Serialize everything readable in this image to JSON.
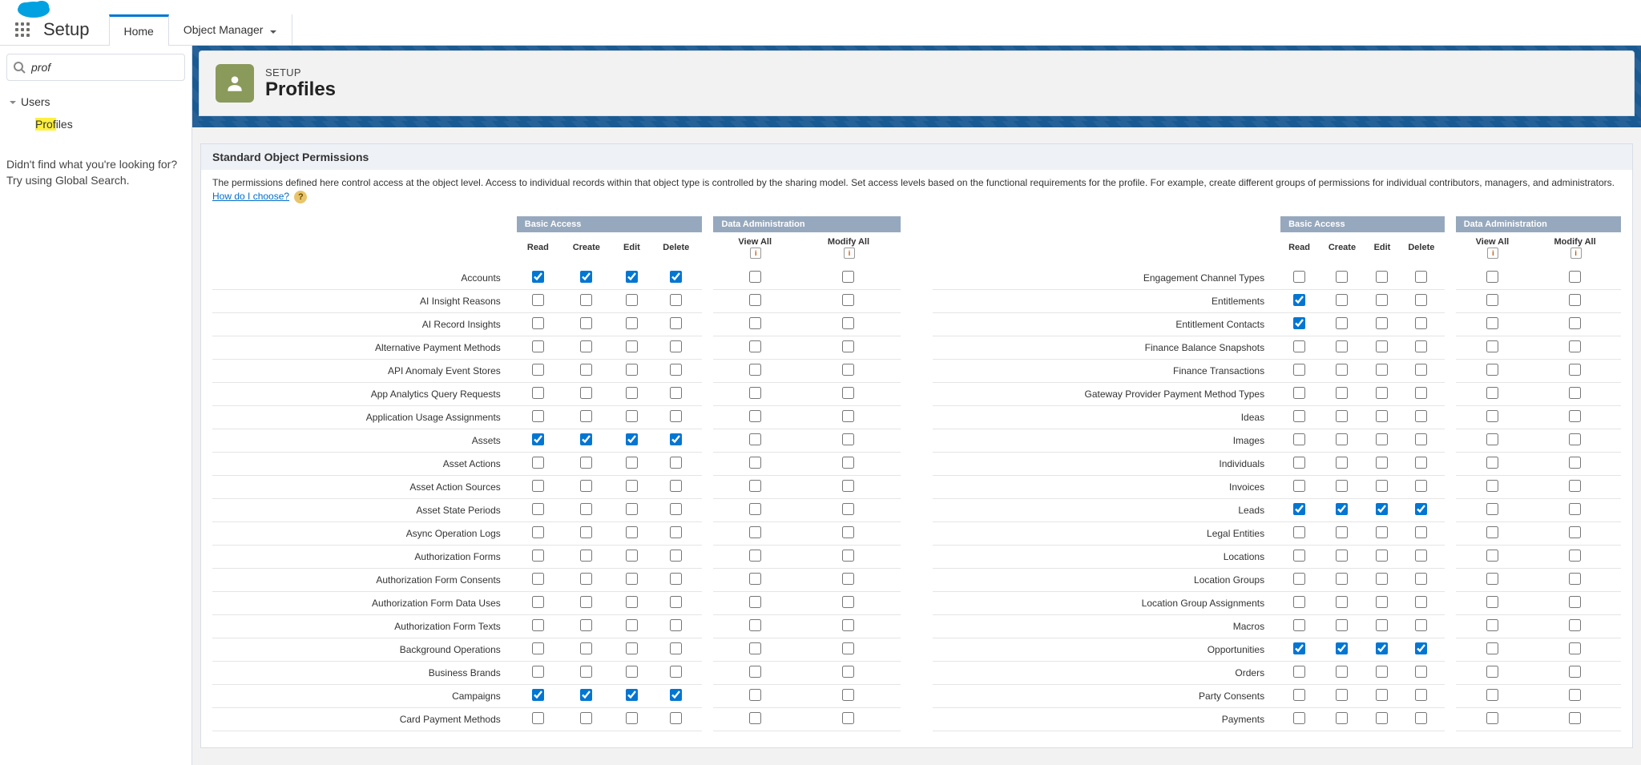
{
  "top": {
    "app_label": "Setup",
    "tabs": [
      {
        "label": "Home",
        "active": true
      },
      {
        "label": "Object Manager",
        "active": false,
        "dropdown": true
      }
    ]
  },
  "sidebar": {
    "search_value": "prof",
    "tree": {
      "root_label": "Users",
      "child_prefix": "Prof",
      "child_suffix": "iles"
    },
    "help_line1": "Didn't find what you're looking for?",
    "help_line2": "Try using Global Search."
  },
  "header": {
    "eyebrow": "SETUP",
    "title": "Profiles"
  },
  "section": {
    "title": "Standard Object Permissions",
    "desc_prefix": "The permissions defined here control access at the object level. Access to individual records within that object type is controlled by the sharing model. Set access levels based on the functional requirements for the profile. For example, create different groups of permissions for individual contributors, managers, and administrators. ",
    "link_text": "How do I choose?"
  },
  "columns": {
    "group_basic": "Basic Access",
    "group_data": "Data Administration",
    "cols": [
      "Read",
      "Create",
      "Edit",
      "Delete",
      "View All",
      "Modify All"
    ]
  },
  "permissions_left": [
    {
      "label": "Accounts",
      "c": [
        true,
        true,
        true,
        true,
        false,
        false
      ]
    },
    {
      "label": "AI Insight Reasons",
      "c": [
        false,
        false,
        false,
        false,
        false,
        false
      ]
    },
    {
      "label": "AI Record Insights",
      "c": [
        false,
        false,
        false,
        false,
        false,
        false
      ]
    },
    {
      "label": "Alternative Payment Methods",
      "c": [
        false,
        false,
        false,
        false,
        false,
        false
      ]
    },
    {
      "label": "API Anomaly Event Stores",
      "c": [
        false,
        false,
        false,
        false,
        false,
        false
      ]
    },
    {
      "label": "App Analytics Query Requests",
      "c": [
        false,
        false,
        false,
        false,
        false,
        false
      ]
    },
    {
      "label": "Application Usage Assignments",
      "c": [
        false,
        false,
        false,
        false,
        false,
        false
      ]
    },
    {
      "label": "Assets",
      "c": [
        true,
        true,
        true,
        true,
        false,
        false
      ]
    },
    {
      "label": "Asset Actions",
      "c": [
        false,
        false,
        false,
        false,
        false,
        false
      ]
    },
    {
      "label": "Asset Action Sources",
      "c": [
        false,
        false,
        false,
        false,
        false,
        false
      ]
    },
    {
      "label": "Asset State Periods",
      "c": [
        false,
        false,
        false,
        false,
        false,
        false
      ]
    },
    {
      "label": "Async Operation Logs",
      "c": [
        false,
        false,
        false,
        false,
        false,
        false
      ]
    },
    {
      "label": "Authorization Forms",
      "c": [
        false,
        false,
        false,
        false,
        false,
        false
      ]
    },
    {
      "label": "Authorization Form Consents",
      "c": [
        false,
        false,
        false,
        false,
        false,
        false
      ]
    },
    {
      "label": "Authorization Form Data Uses",
      "c": [
        false,
        false,
        false,
        false,
        false,
        false
      ]
    },
    {
      "label": "Authorization Form Texts",
      "c": [
        false,
        false,
        false,
        false,
        false,
        false
      ]
    },
    {
      "label": "Background Operations",
      "c": [
        false,
        false,
        false,
        false,
        false,
        false
      ]
    },
    {
      "label": "Business Brands",
      "c": [
        false,
        false,
        false,
        false,
        false,
        false
      ]
    },
    {
      "label": "Campaigns",
      "c": [
        true,
        true,
        true,
        true,
        false,
        false
      ]
    },
    {
      "label": "Card Payment Methods",
      "c": [
        false,
        false,
        false,
        false,
        false,
        false
      ]
    }
  ],
  "permissions_right": [
    {
      "label": "Engagement Channel Types",
      "c": [
        false,
        false,
        false,
        false,
        false,
        false
      ]
    },
    {
      "label": "Entitlements",
      "c": [
        true,
        false,
        false,
        false,
        false,
        false
      ]
    },
    {
      "label": "Entitlement Contacts",
      "c": [
        true,
        false,
        false,
        false,
        false,
        false
      ]
    },
    {
      "label": "Finance Balance Snapshots",
      "c": [
        false,
        false,
        false,
        false,
        false,
        false
      ]
    },
    {
      "label": "Finance Transactions",
      "c": [
        false,
        false,
        false,
        false,
        false,
        false
      ]
    },
    {
      "label": "Gateway Provider Payment Method Types",
      "c": [
        false,
        false,
        false,
        false,
        false,
        false
      ]
    },
    {
      "label": "Ideas",
      "c": [
        false,
        false,
        false,
        false,
        false,
        false
      ]
    },
    {
      "label": "Images",
      "c": [
        false,
        false,
        false,
        false,
        false,
        false
      ]
    },
    {
      "label": "Individuals",
      "c": [
        false,
        false,
        false,
        false,
        false,
        false
      ]
    },
    {
      "label": "Invoices",
      "c": [
        false,
        false,
        false,
        false,
        false,
        false
      ]
    },
    {
      "label": "Leads",
      "c": [
        true,
        true,
        true,
        true,
        false,
        false
      ]
    },
    {
      "label": "Legal Entities",
      "c": [
        false,
        false,
        false,
        false,
        false,
        false
      ]
    },
    {
      "label": "Locations",
      "c": [
        false,
        false,
        false,
        false,
        false,
        false
      ]
    },
    {
      "label": "Location Groups",
      "c": [
        false,
        false,
        false,
        false,
        false,
        false
      ]
    },
    {
      "label": "Location Group Assignments",
      "c": [
        false,
        false,
        false,
        false,
        false,
        false
      ]
    },
    {
      "label": "Macros",
      "c": [
        false,
        false,
        false,
        false,
        false,
        false
      ]
    },
    {
      "label": "Opportunities",
      "c": [
        true,
        true,
        true,
        true,
        false,
        false
      ]
    },
    {
      "label": "Orders",
      "c": [
        false,
        false,
        false,
        false,
        false,
        false
      ]
    },
    {
      "label": "Party Consents",
      "c": [
        false,
        false,
        false,
        false,
        false,
        false
      ]
    },
    {
      "label": "Payments",
      "c": [
        false,
        false,
        false,
        false,
        false,
        false
      ]
    }
  ]
}
